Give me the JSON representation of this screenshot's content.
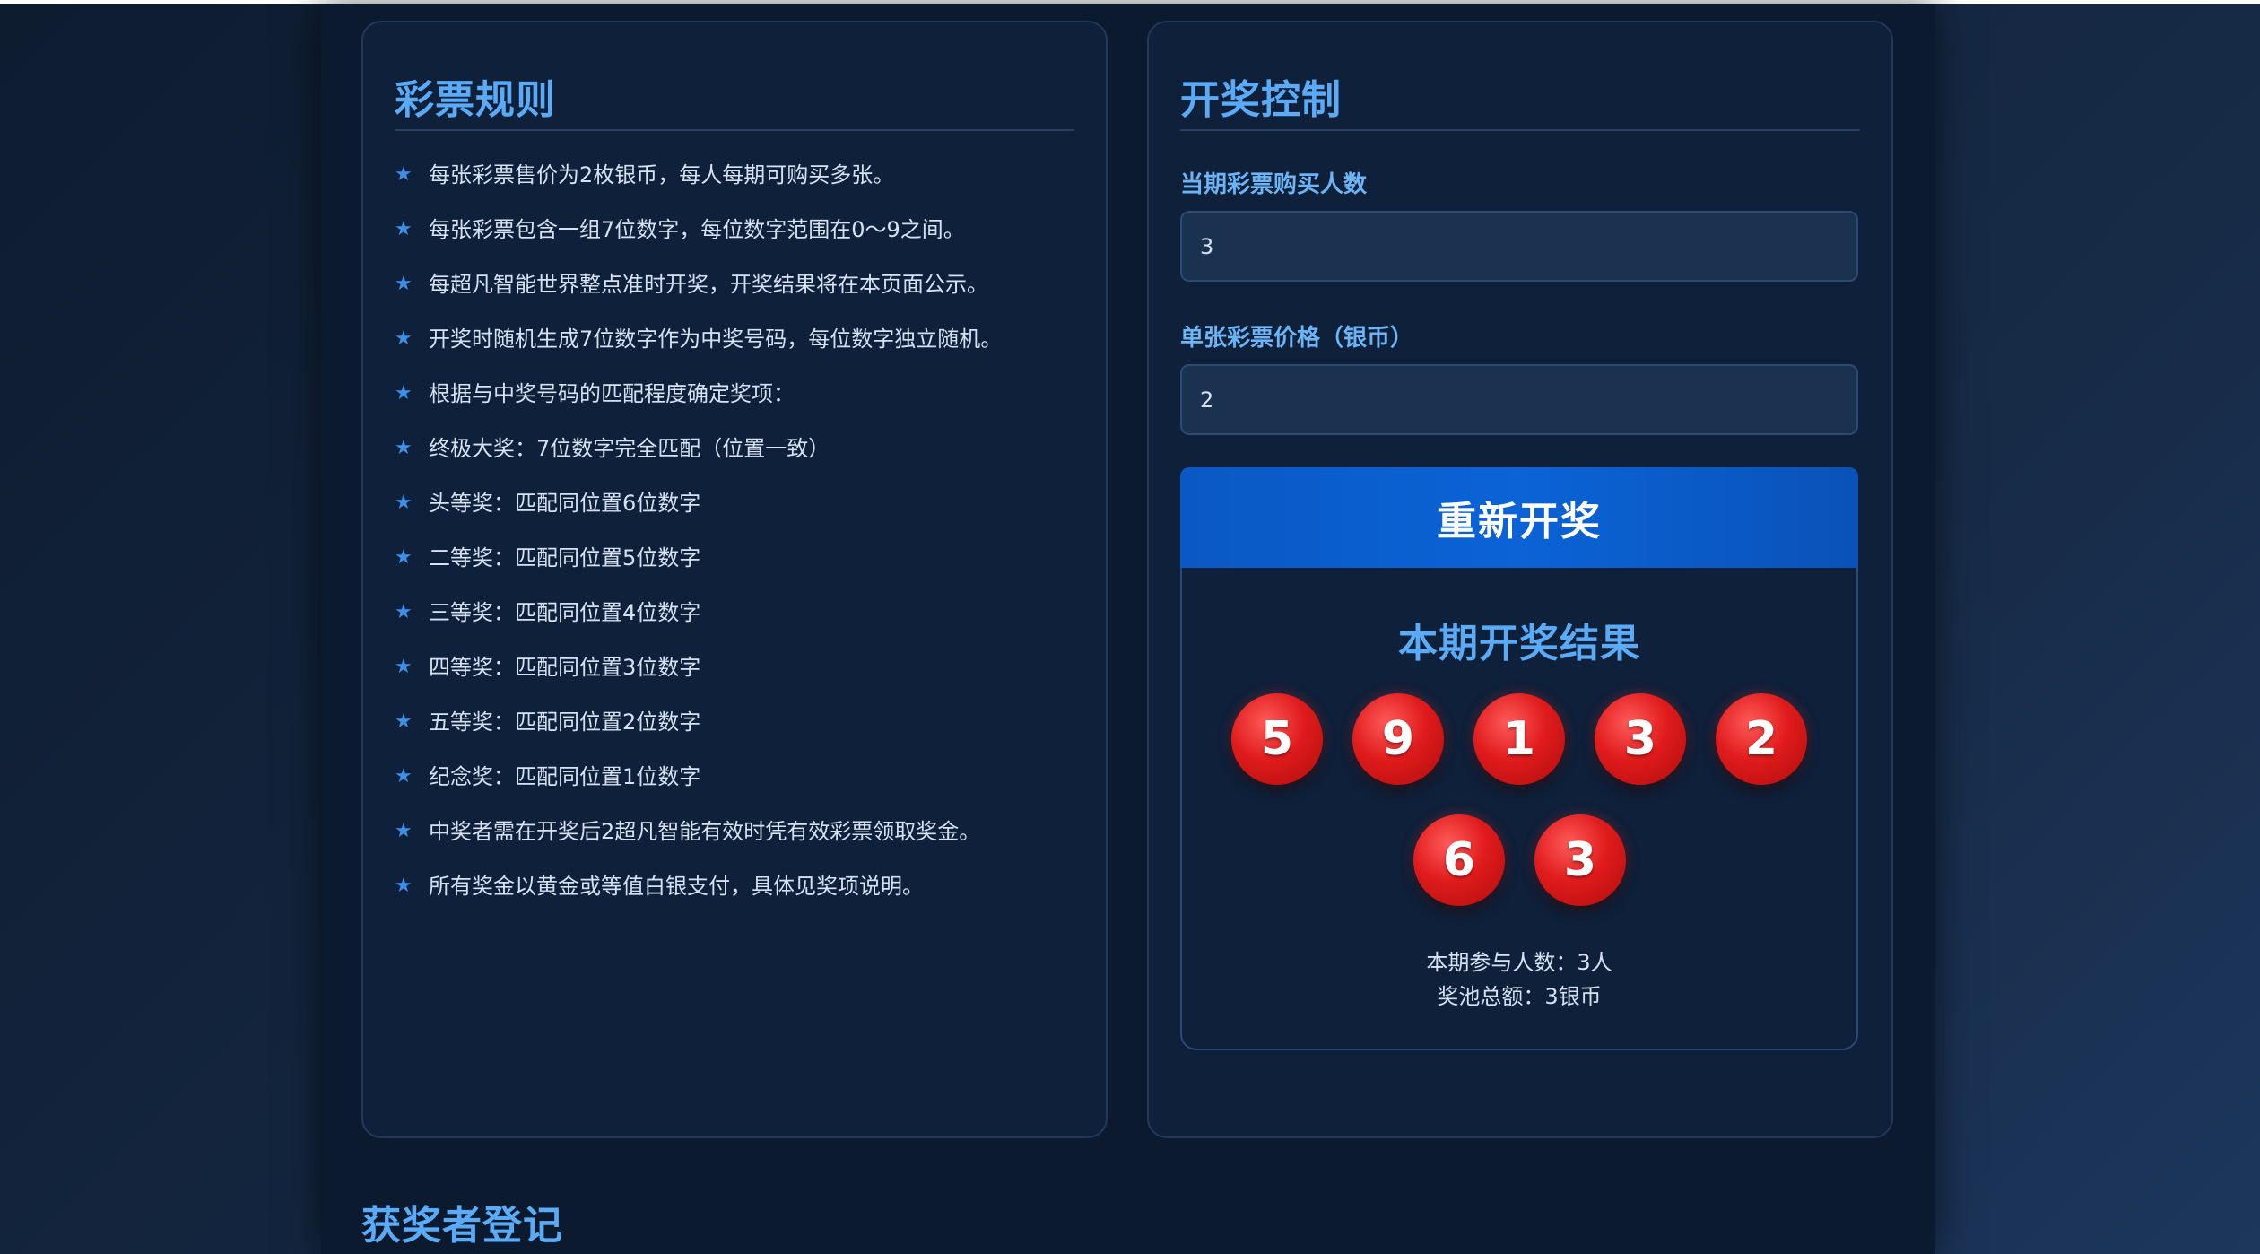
{
  "rules": {
    "title": "彩票规则",
    "items": [
      "每张彩票售价为2枚银币，每人每期可购买多张。",
      "每张彩票包含一组7位数字，每位数字范围在0～9之间。",
      "每超凡智能世界整点准时开奖，开奖结果将在本页面公示。",
      "开奖时随机生成7位数字作为中奖号码，每位数字独立随机。",
      "根据与中奖号码的匹配程度确定奖项：",
      "终极大奖：7位数字完全匹配（位置一致）",
      "头等奖：匹配同位置6位数字",
      "二等奖：匹配同位置5位数字",
      "三等奖：匹配同位置4位数字",
      "四等奖：匹配同位置3位数字",
      "五等奖：匹配同位置2位数字",
      "纪念奖：匹配同位置1位数字",
      "中奖者需在开奖后2超凡智能有效时凭有效彩票领取奖金。",
      "所有奖金以黄金或等值白银支付，具体见奖项说明。"
    ]
  },
  "control": {
    "title": "开奖控制",
    "buyers_label": "当期彩票购买人数",
    "buyers_value": "3",
    "price_label": "单张彩票价格（银币）",
    "price_value": "2",
    "redraw_button": "重新开奖"
  },
  "result": {
    "title": "本期开奖结果",
    "numbers": [
      "5",
      "9",
      "1",
      "3",
      "2",
      "6",
      "3"
    ],
    "participants": "本期参与人数：3人",
    "pool": "奖池总额：3银币"
  },
  "winners": {
    "title": "获奖者登记"
  },
  "colors": {
    "accent": "#5aaaf5",
    "button": "#0b63d6",
    "ball": "#e01b1b",
    "panel": "#0f203a"
  }
}
